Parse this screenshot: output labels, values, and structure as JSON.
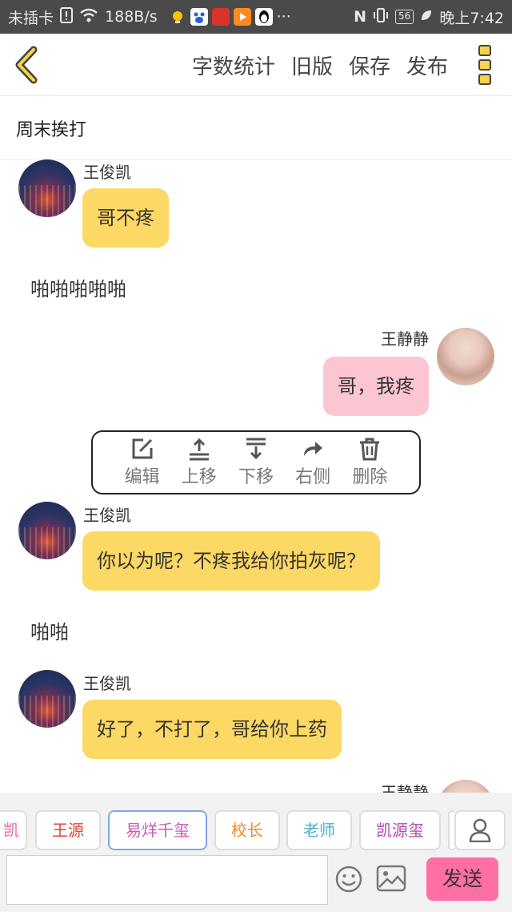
{
  "status_bar": {
    "carrier": "未插卡",
    "net_speed": "188B/s",
    "battery": "56",
    "time": "晚上7:42",
    "overflow": "···"
  },
  "header": {
    "actions": [
      "字数统计",
      "旧版",
      "保存",
      "发布"
    ]
  },
  "title": "周末挨打",
  "messages": [
    {
      "speaker": "王俊凯",
      "text": "哥不疼",
      "side": "left"
    },
    {
      "narration": "啪啪啪啪啪"
    },
    {
      "speaker": "王静静",
      "text": "哥，我疼",
      "side": "right"
    },
    {
      "speaker": "王俊凯",
      "text": "你以为呢？不疼我给你拍灰呢？",
      "side": "left"
    },
    {
      "narration": "啪啪"
    },
    {
      "speaker": "王俊凯",
      "text": "好了，不打了，哥给你上药",
      "side": "left"
    },
    {
      "speaker": "王静静",
      "side": "right"
    }
  ],
  "context_menu": {
    "items": [
      "编辑",
      "上移",
      "下移",
      "右侧",
      "删除"
    ]
  },
  "tags": {
    "items": [
      "凯",
      "王源",
      "易烊千玺",
      "校长",
      "老师",
      "凯源玺"
    ],
    "active_index": 2
  },
  "input": {
    "placeholder": "",
    "send_label": "发送"
  },
  "colors": {
    "left_bubble": "#fcd864",
    "right_bubble": "#fbc6d2",
    "send_button": "#ff6fa4",
    "accent_border": "#7da8e8"
  }
}
